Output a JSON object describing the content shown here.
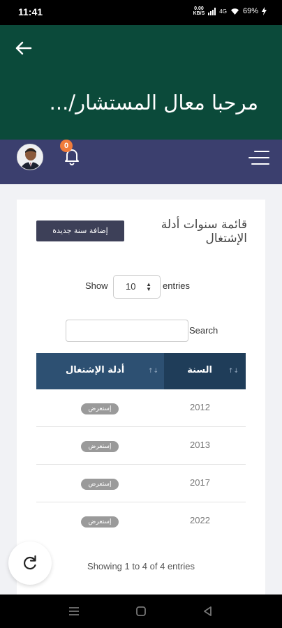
{
  "status_bar": {
    "time": "11:41",
    "speed_value": "0.00",
    "speed_unit": "KB/S",
    "network": "4G",
    "battery": "69%"
  },
  "header": {
    "greeting": "مرحبا معال المستشار/..."
  },
  "nav": {
    "notification_count": "0"
  },
  "card": {
    "title": "قائمة سنوات أدلة الإشتغال",
    "add_button": "إضافة سنة جديدة",
    "show_label": "Show",
    "entries_value": "10",
    "entries_label": "entries",
    "search_label": "Search",
    "search_value": "",
    "columns": [
      "السنة",
      "أدلة الإشتغال"
    ],
    "rows": [
      {
        "year": "2012",
        "action": "إستعرض"
      },
      {
        "year": "2013",
        "action": "إستعرض"
      },
      {
        "year": "2017",
        "action": "إستعرض"
      },
      {
        "year": "2022",
        "action": "إستعرض"
      }
    ],
    "info": "Showing 1 to 4 of 4 entries"
  },
  "colors": {
    "header_bg": "#0b4a3a",
    "nav_bg": "#3b3f6e",
    "table_head": "#2d5072",
    "table_head_active": "#1f3d59",
    "badge": "#f07b3b"
  }
}
